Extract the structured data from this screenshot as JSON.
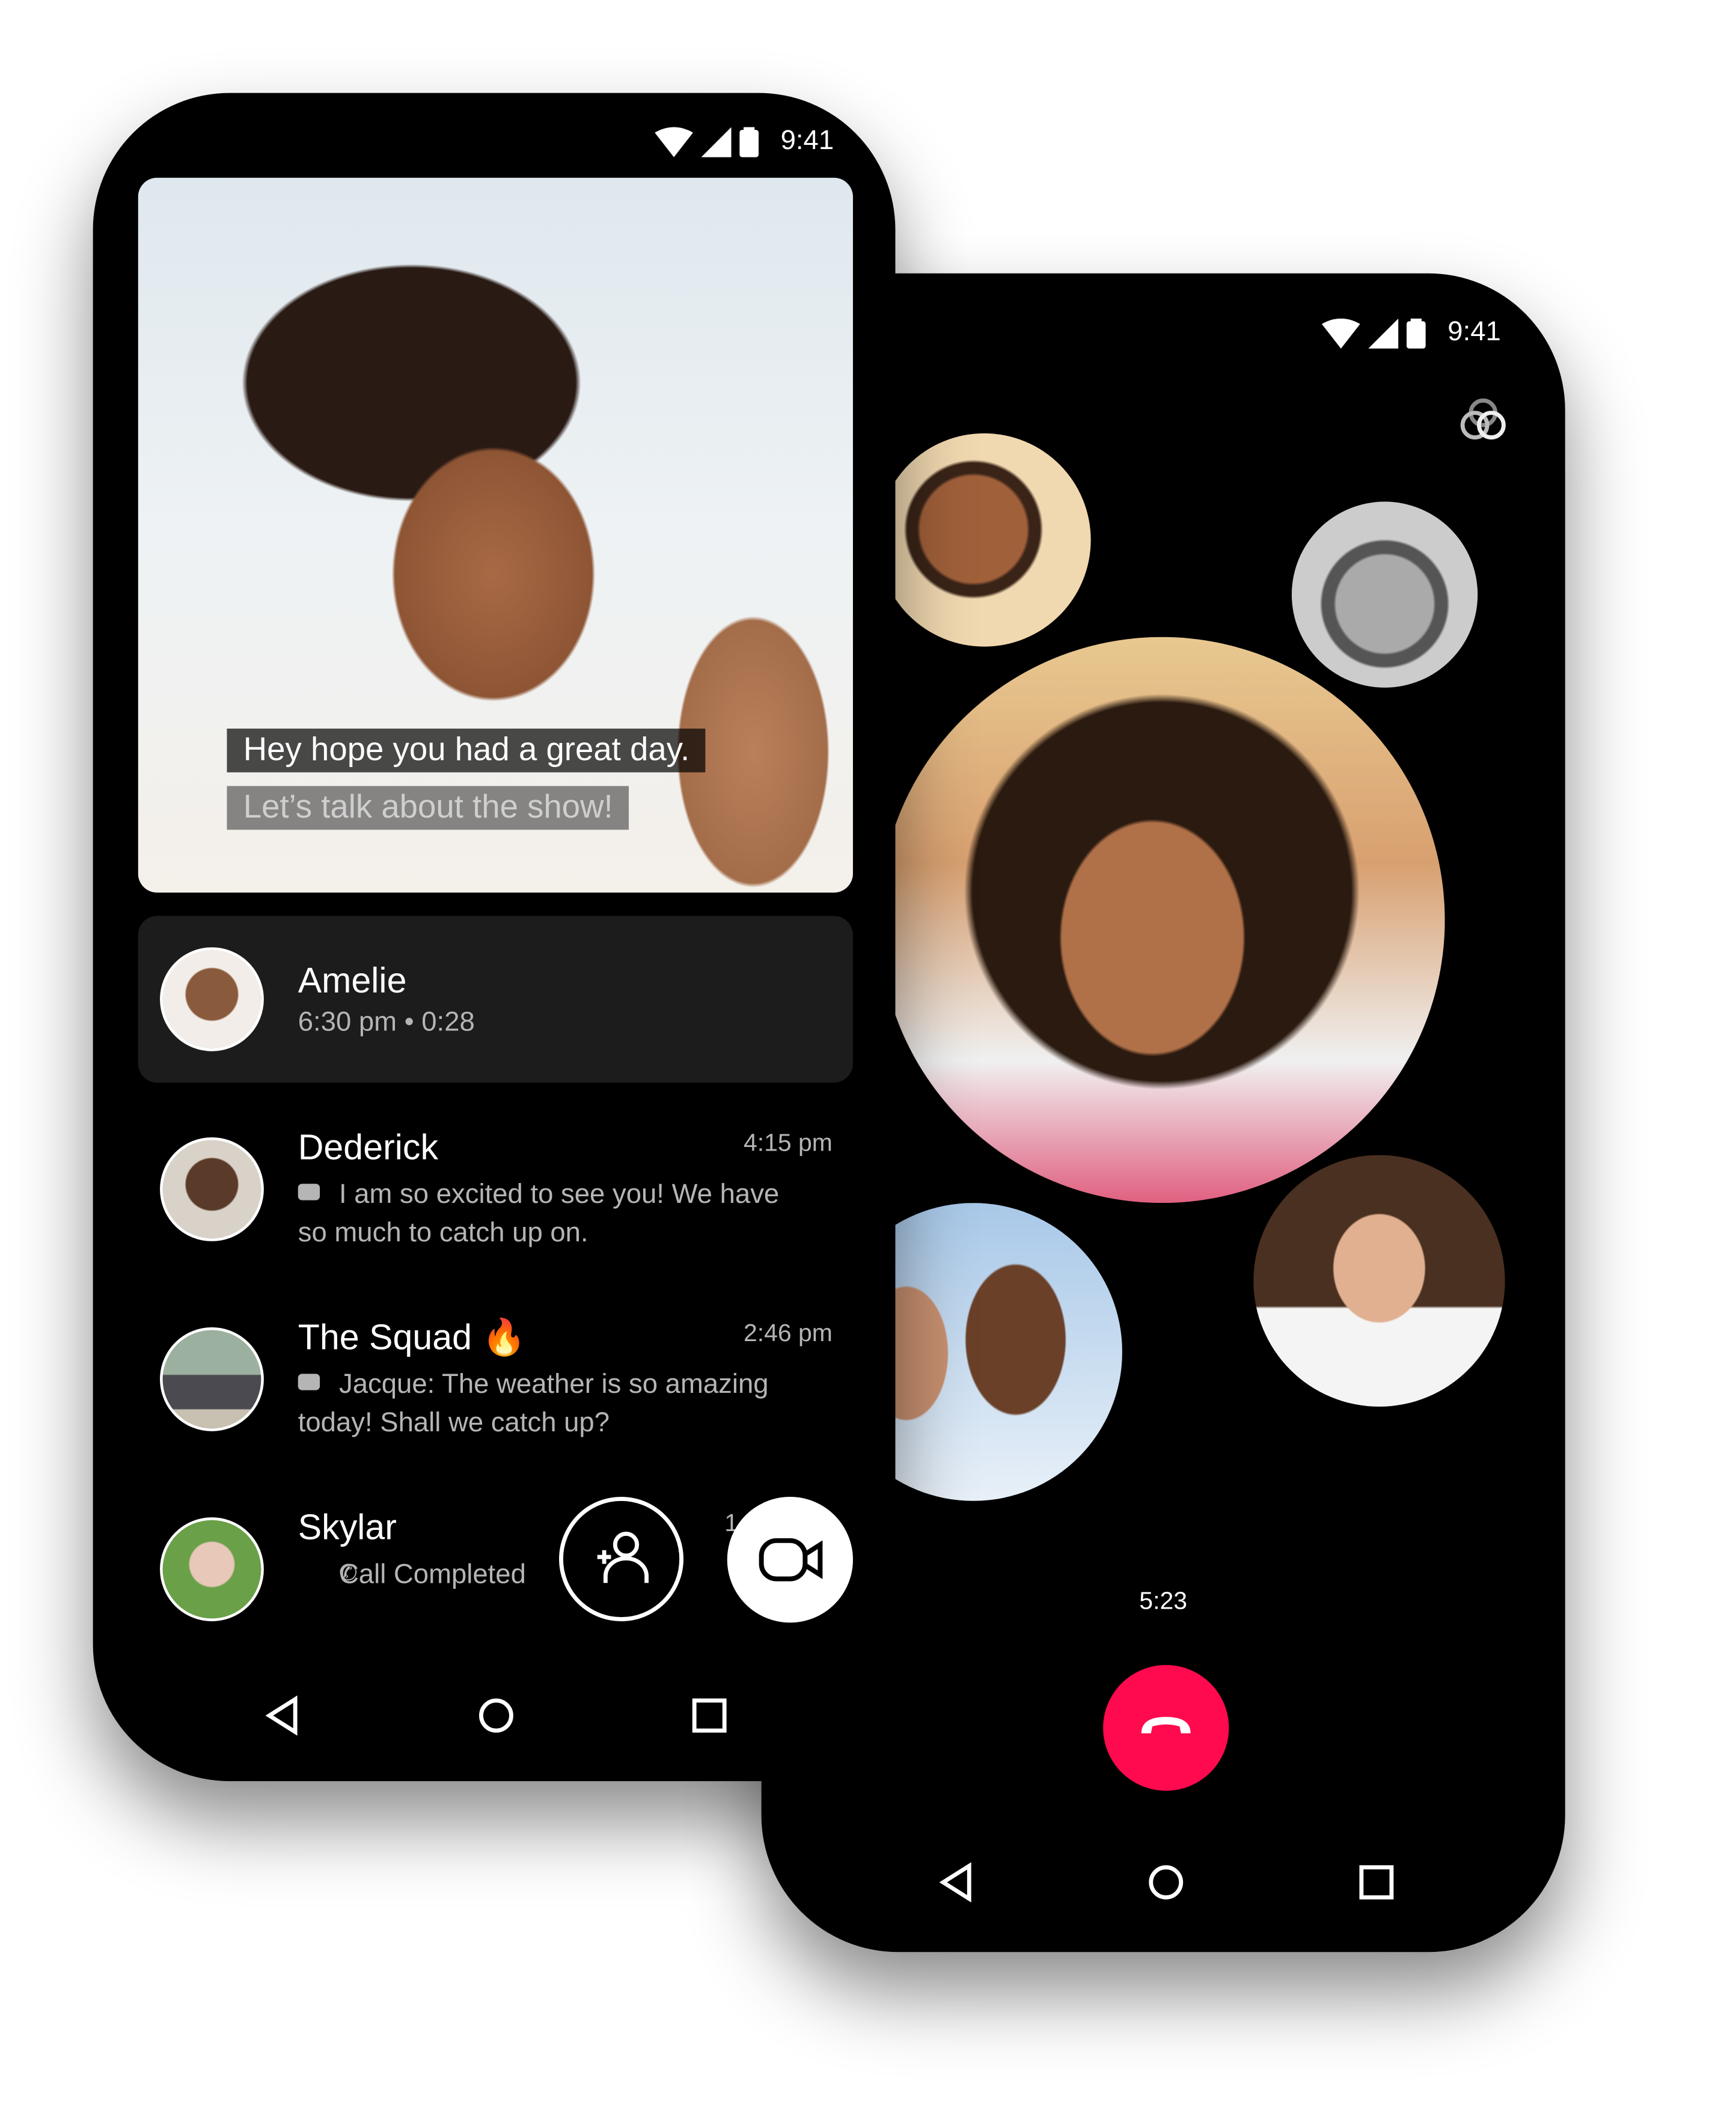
{
  "left_phone": {
    "status": {
      "time": "9:41",
      "icons": [
        "wifi-icon",
        "signal-icon",
        "battery-icon"
      ]
    },
    "video": {
      "captions": [
        "Hey hope you had a great day.",
        "Let’s talk about the show!"
      ]
    },
    "active_call": {
      "name": "Amelie",
      "detail": "6:30 pm • 0:28"
    },
    "conversations": [
      {
        "name": "Dederick",
        "time": "4:15 pm",
        "icon": "video-icon",
        "message": "I am so excited to see you! We have so much to catch up on."
      },
      {
        "name": "The Squad",
        "emoji": "🔥",
        "time": "2:46 pm",
        "icon": "video-icon",
        "message": "Jacque: The weather is so amazing today! Shall we catch up?"
      },
      {
        "name": "Skylar",
        "time": "1",
        "icon": "phone-icon",
        "message": "Call Completed"
      }
    ],
    "fab": {
      "add_person": "add-person-icon",
      "new_video": "video-camera-icon"
    },
    "nav": [
      "back-icon",
      "home-icon",
      "recents-icon"
    ]
  },
  "right_phone": {
    "status": {
      "time": "9:41"
    },
    "effects_icon": "effects-icon",
    "call_timer": "5:23",
    "end_call_color": "#ff0a4e",
    "nav": [
      "back-icon",
      "home-icon",
      "recents-icon"
    ]
  }
}
